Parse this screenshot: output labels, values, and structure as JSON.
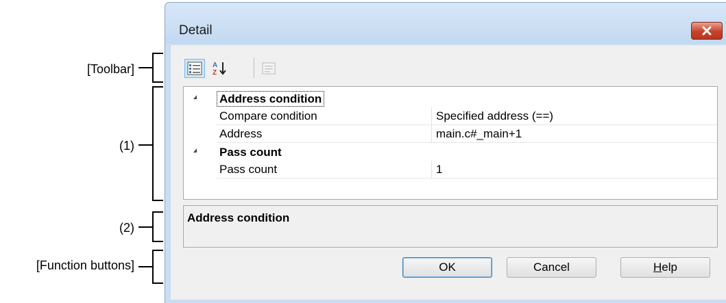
{
  "callouts": {
    "toolbar": "[Toolbar]",
    "grid": "(1)",
    "description": "(2)",
    "function_buttons": "[Function buttons]"
  },
  "window": {
    "title": "Detail",
    "close_icon": "close-x-icon"
  },
  "toolbar": {
    "buttons": [
      {
        "icon": "categorized-view-icon",
        "active": true
      },
      {
        "icon": "sort-alphabetical-icon",
        "active": false
      },
      {
        "icon": "property-pages-icon",
        "active": false,
        "disabled": true
      }
    ]
  },
  "grid": {
    "categories": [
      {
        "label": "Address condition",
        "properties": [
          {
            "name": "Compare condition",
            "value": "Specified address (==)"
          },
          {
            "name": "Address",
            "value": "main.c#_main+1"
          }
        ]
      },
      {
        "label": "Pass count",
        "properties": [
          {
            "name": "Pass count",
            "value": "1"
          }
        ]
      }
    ]
  },
  "description": {
    "title": "Address condition"
  },
  "buttons": {
    "ok": "OK",
    "cancel": "Cancel",
    "help_mnemonic": "H",
    "help_rest": "elp"
  }
}
